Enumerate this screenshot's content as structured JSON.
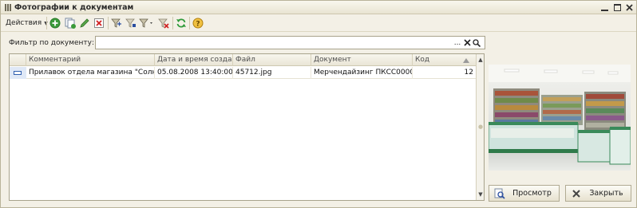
{
  "window": {
    "title": "Фотографии к документам"
  },
  "toolbar": {
    "actions_label": "Действия",
    "icons": [
      "add-icon",
      "copy-icon",
      "edit-icon",
      "delete-icon",
      "filter-set-icon",
      "filter-by-value-icon",
      "filter-history-icon",
      "filter-clear-icon",
      "refresh-icon",
      "help-icon"
    ]
  },
  "filter": {
    "label": "Фильтр по документу:",
    "value": "",
    "select_label": "..."
  },
  "table": {
    "columns": [
      "Комментарий",
      "Дата и время созда...",
      "Файл",
      "Документ",
      "Код"
    ],
    "rows": [
      {
        "comment": "Прилавок отдела магазина \"Солн...",
        "datetime": "05.08.2008 13:40:00",
        "file": "45712.jpg",
        "document": "Мерчендайзинг ПКСС0000...",
        "code": "12"
      }
    ]
  },
  "buttons": {
    "view": "Просмотр",
    "close": "Закрыть"
  },
  "colors": {
    "window_bg": "#f3f0e6",
    "selection": "#dfe8f6",
    "accent_green": "#3a9a3a"
  }
}
